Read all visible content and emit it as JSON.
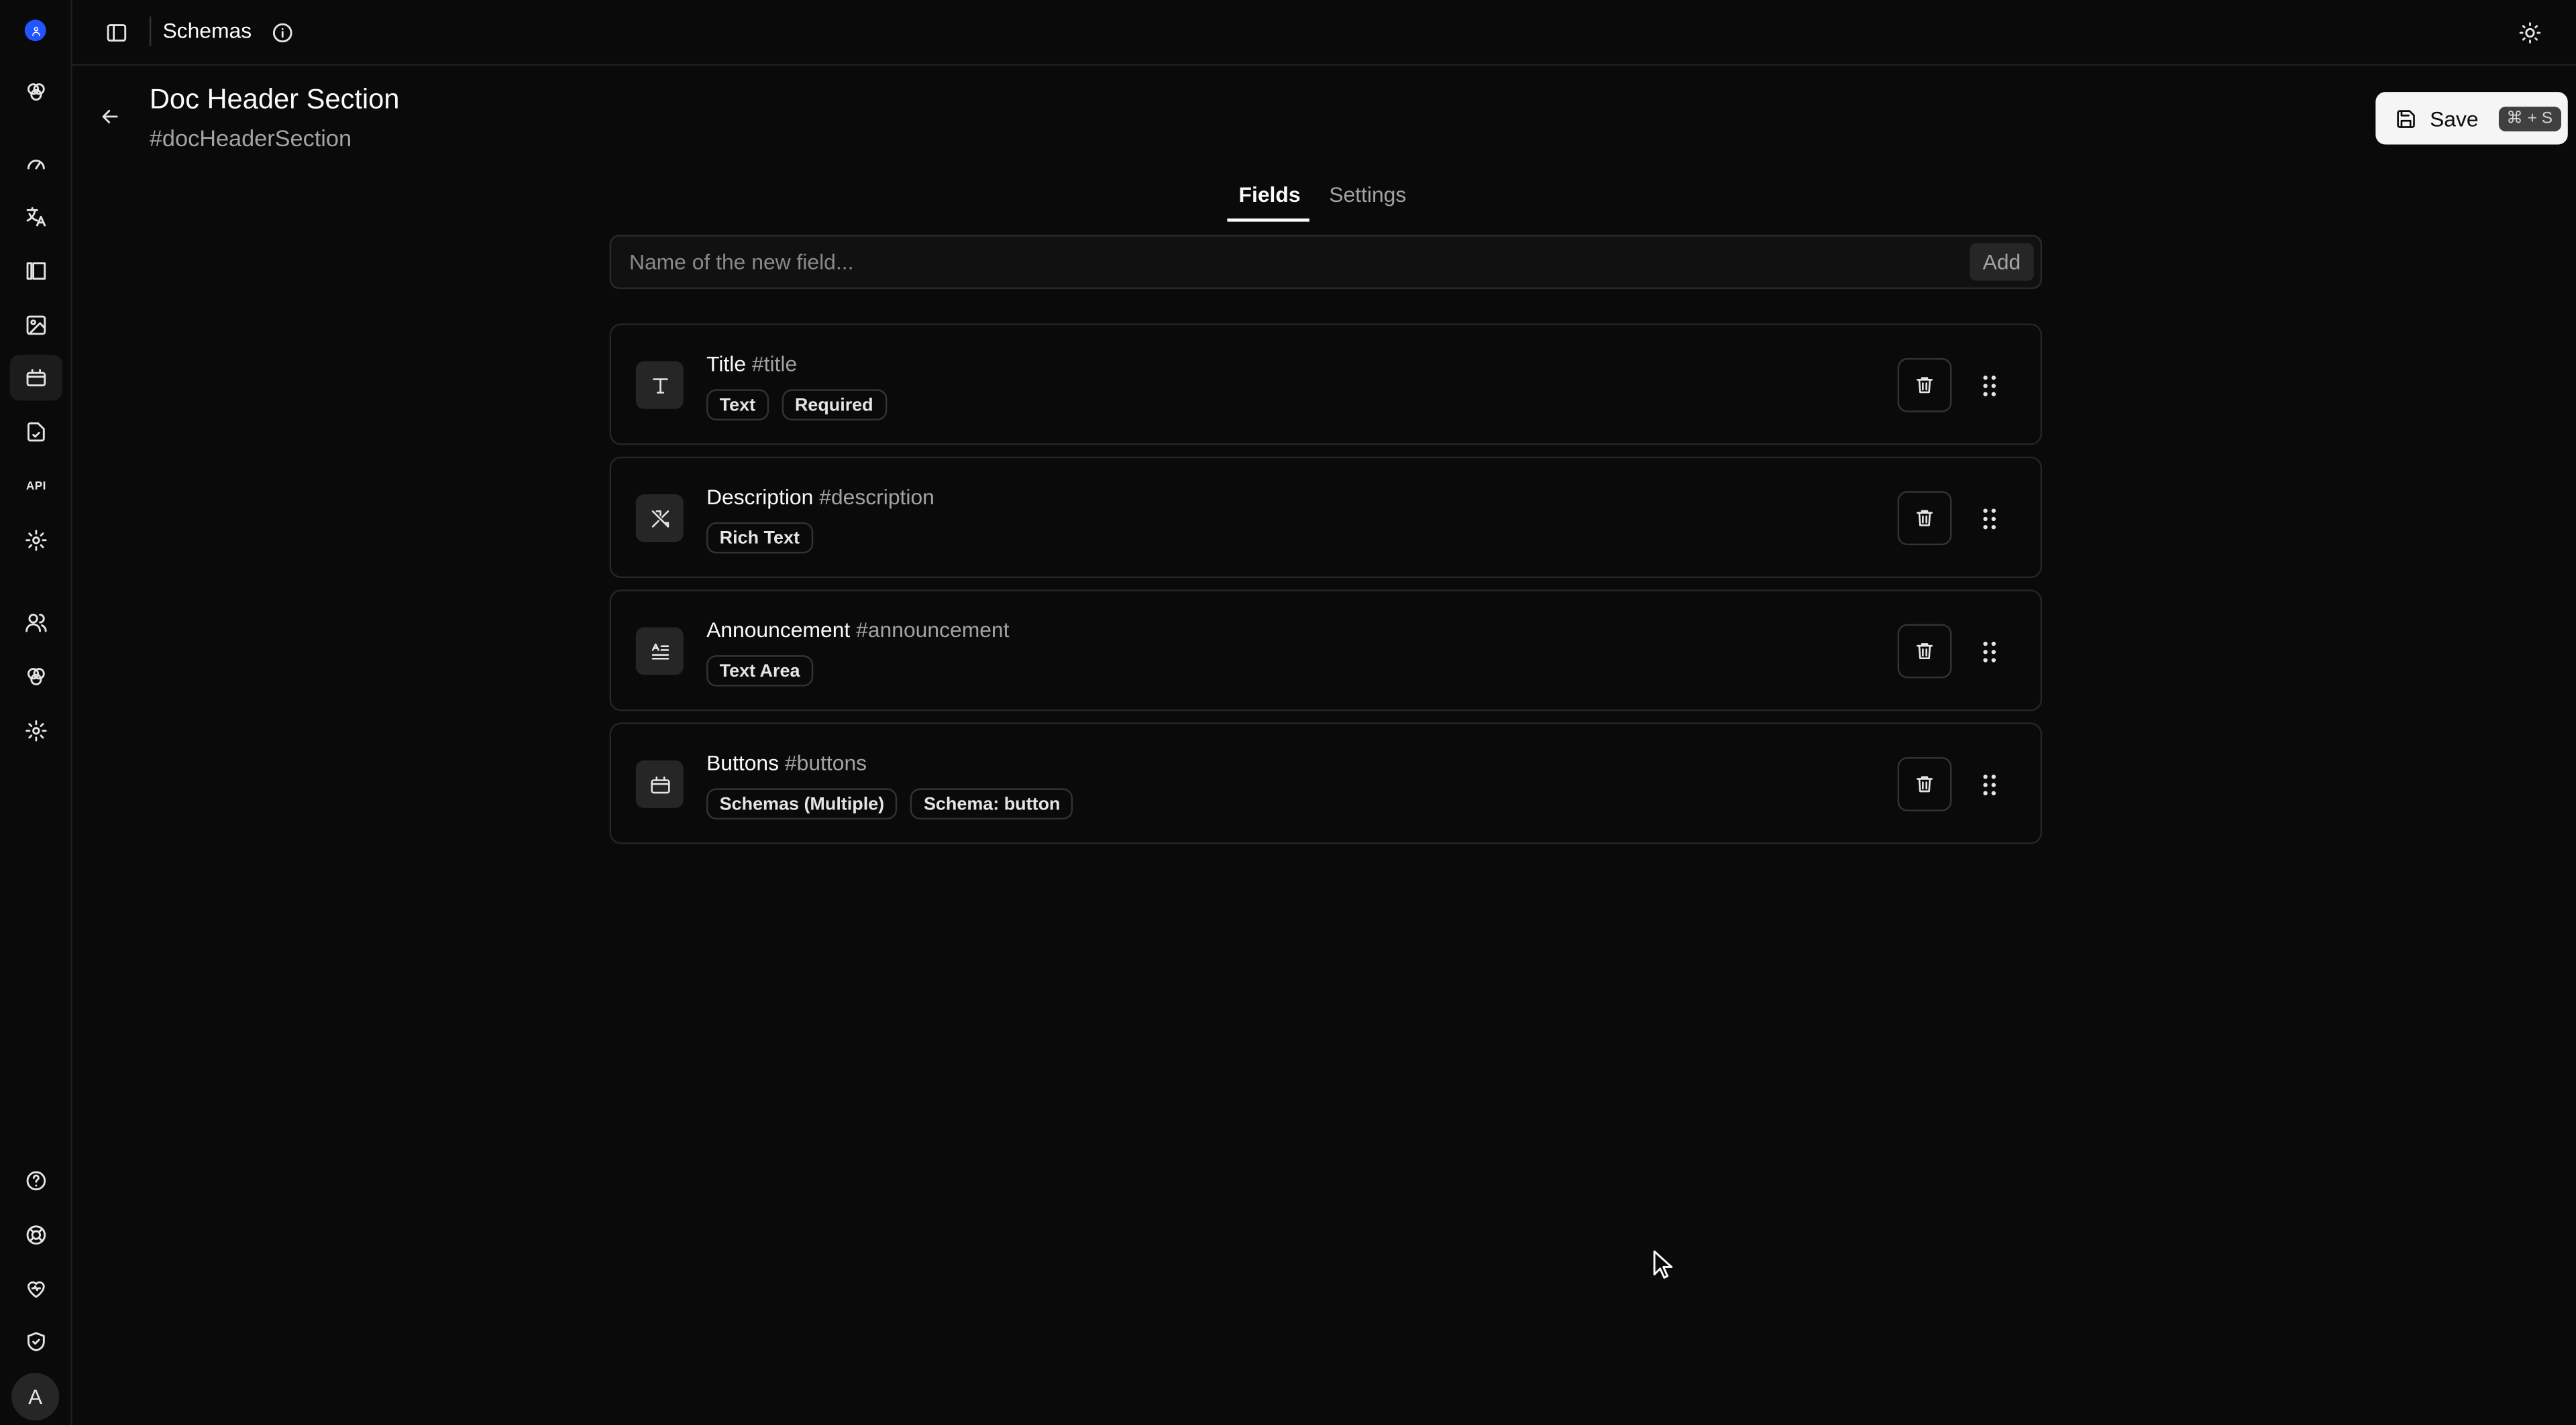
{
  "topbar": {
    "title": "Schemas"
  },
  "header": {
    "title": "Doc Header Section",
    "key": "#docHeaderSection"
  },
  "save": {
    "label": "Save",
    "shortcut": "⌘ + S"
  },
  "tabs": [
    {
      "label": "Fields",
      "active": true
    },
    {
      "label": "Settings",
      "active": false
    }
  ],
  "new_field": {
    "placeholder": "Name of the new field...",
    "add_label": "Add"
  },
  "fields": [
    {
      "name": "Title",
      "key": "#title",
      "icon": "text-type-icon",
      "badges": [
        "Text",
        "Required"
      ]
    },
    {
      "name": "Description",
      "key": "#description",
      "icon": "rich-text-icon",
      "badges": [
        "Rich Text"
      ]
    },
    {
      "name": "Announcement",
      "key": "#announcement",
      "icon": "text-area-icon",
      "badges": [
        "Text Area"
      ]
    },
    {
      "name": "Buttons",
      "key": "#buttons",
      "icon": "schema-box-icon",
      "badges": [
        "Schemas (Multiple)",
        "Schema: button"
      ]
    }
  ],
  "user": {
    "avatar_initial": "A"
  },
  "sidebar_icons": [
    "logo-icon",
    "spaces-icon",
    "dashboard-icon",
    "translate-icon",
    "library-icon",
    "assets-icon",
    "schemas-icon",
    "tasks-icon",
    "api-icon",
    "settings-icon",
    "users-icon",
    "spaces-icon",
    "settings-icon",
    "help-icon",
    "support-icon",
    "health-icon",
    "security-icon"
  ]
}
